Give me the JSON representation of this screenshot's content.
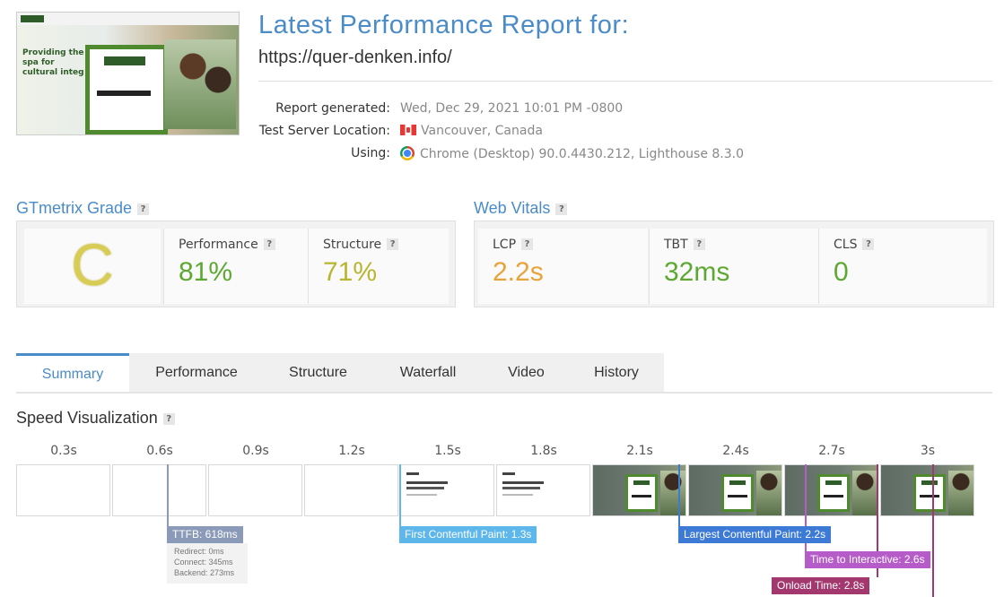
{
  "header": {
    "title": "Latest Performance Report for:",
    "url": "https://quer-denken.info/",
    "report_generated_label": "Report generated:",
    "report_generated_value": "Wed, Dec 29, 2021 10:01 PM -0800",
    "server_label": "Test Server Location:",
    "server_value": "Vancouver, Canada",
    "using_label": "Using:",
    "using_value": "Chrome (Desktop) 90.0.4430.212, Lighthouse 8.3.0",
    "thumbnail_text": "Providing the spa for cultural integ"
  },
  "grade": {
    "heading": "GTmetrix Grade",
    "help": "?",
    "letter": "C",
    "performance_label": "Performance",
    "performance_value": "81%",
    "structure_label": "Structure",
    "structure_value": "71%"
  },
  "vitals": {
    "heading": "Web Vitals",
    "help": "?",
    "lcp_label": "LCP",
    "lcp_value": "2.2s",
    "tbt_label": "TBT",
    "tbt_value": "32ms",
    "cls_label": "CLS",
    "cls_value": "0"
  },
  "tabs": [
    "Summary",
    "Performance",
    "Structure",
    "Waterfall",
    "Video",
    "History"
  ],
  "speed": {
    "heading": "Speed Visualization",
    "help": "?",
    "ticks": [
      "0.3s",
      "0.6s",
      "0.9s",
      "1.2s",
      "1.5s",
      "1.8s",
      "2.1s",
      "2.4s",
      "2.7s",
      "3s"
    ],
    "ttfb_label": "TTFB: 618ms",
    "ttfb_redirect": "Redirect: 0ms",
    "ttfb_connect": "Connect: 345ms",
    "ttfb_backend": "Backend: 273ms",
    "fcp_label": "First Contentful Paint: 1.3s",
    "lcp_label": "Largest Contentful Paint: 2.2s",
    "tti_label": "Time to Interactive: 2.6s",
    "onload_label": "Onload Time: 2.8s"
  },
  "colors": {
    "accent": "#4a8cc8",
    "grade_c": "#d8cc55",
    "good_green": "#5da832",
    "ok_yellow": "#b8b530",
    "lcp_orange": "#e8a33a",
    "ttfb": "#8a9ab8",
    "fcp": "#5eb7ea",
    "lcp_marker": "#3d7ad6",
    "tti": "#b55cc8",
    "onload": "#a2386d"
  }
}
